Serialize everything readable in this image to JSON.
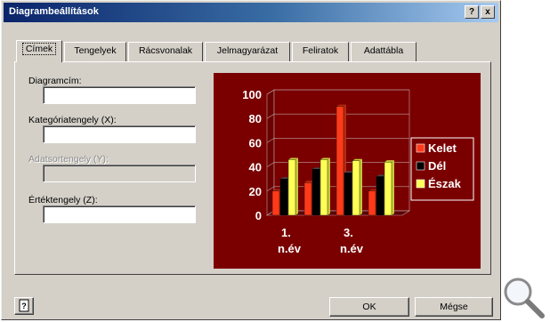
{
  "dialog": {
    "title": "Diagrambeállítások",
    "help_label": "?",
    "close_label": "x"
  },
  "tabs": [
    {
      "label": "Címek"
    },
    {
      "label": "Tengelyek"
    },
    {
      "label": "Rácsvonalak"
    },
    {
      "label": "Jelmagyarázat"
    },
    {
      "label": "Feliratok"
    },
    {
      "label": "Adattábla"
    }
  ],
  "fields": {
    "diagram_title": {
      "label": "Diagramcím:",
      "value": ""
    },
    "category_axis": {
      "label": "Kategóriatengely (X):",
      "value": ""
    },
    "series_axis": {
      "label": "Adatsortengely (Y):",
      "value": ""
    },
    "value_axis": {
      "label": "Értéktengely (Z):",
      "value": ""
    }
  },
  "buttons": {
    "ok": "OK",
    "cancel": "Mégse"
  },
  "colors": {
    "chart_bg": "#7a0000",
    "kelet": "#ff3a1a",
    "del": "#000000",
    "eszak": "#ffff55"
  },
  "chart_data": {
    "type": "bar",
    "categories": [
      "1. n.év",
      "3. n.év"
    ],
    "category_lines": [
      [
        "1.",
        "n.év"
      ],
      [
        "3.",
        "n.év"
      ]
    ],
    "y_ticks": [
      "0",
      "20",
      "40",
      "60",
      "80",
      "100"
    ],
    "ylim": [
      0,
      100
    ],
    "groups": [
      {
        "Kelet": 20,
        "Dél": 30,
        "Észak": 46
      },
      {
        "Kelet": 27,
        "Dél": 38,
        "Észak": 46
      },
      {
        "Kelet": 90,
        "Dél": 35,
        "Észak": 45
      },
      {
        "Kelet": 20,
        "Dél": 32,
        "Észak": 44
      }
    ],
    "series": [
      {
        "name": "Kelet",
        "values": [
          20,
          27,
          90,
          20
        ]
      },
      {
        "name": "Dél",
        "values": [
          30,
          38,
          35,
          32
        ]
      },
      {
        "name": "Észak",
        "values": [
          46,
          46,
          45,
          44
        ]
      }
    ],
    "legend": [
      "Kelet",
      "Dél",
      "Észak"
    ],
    "legend_position": "right"
  }
}
